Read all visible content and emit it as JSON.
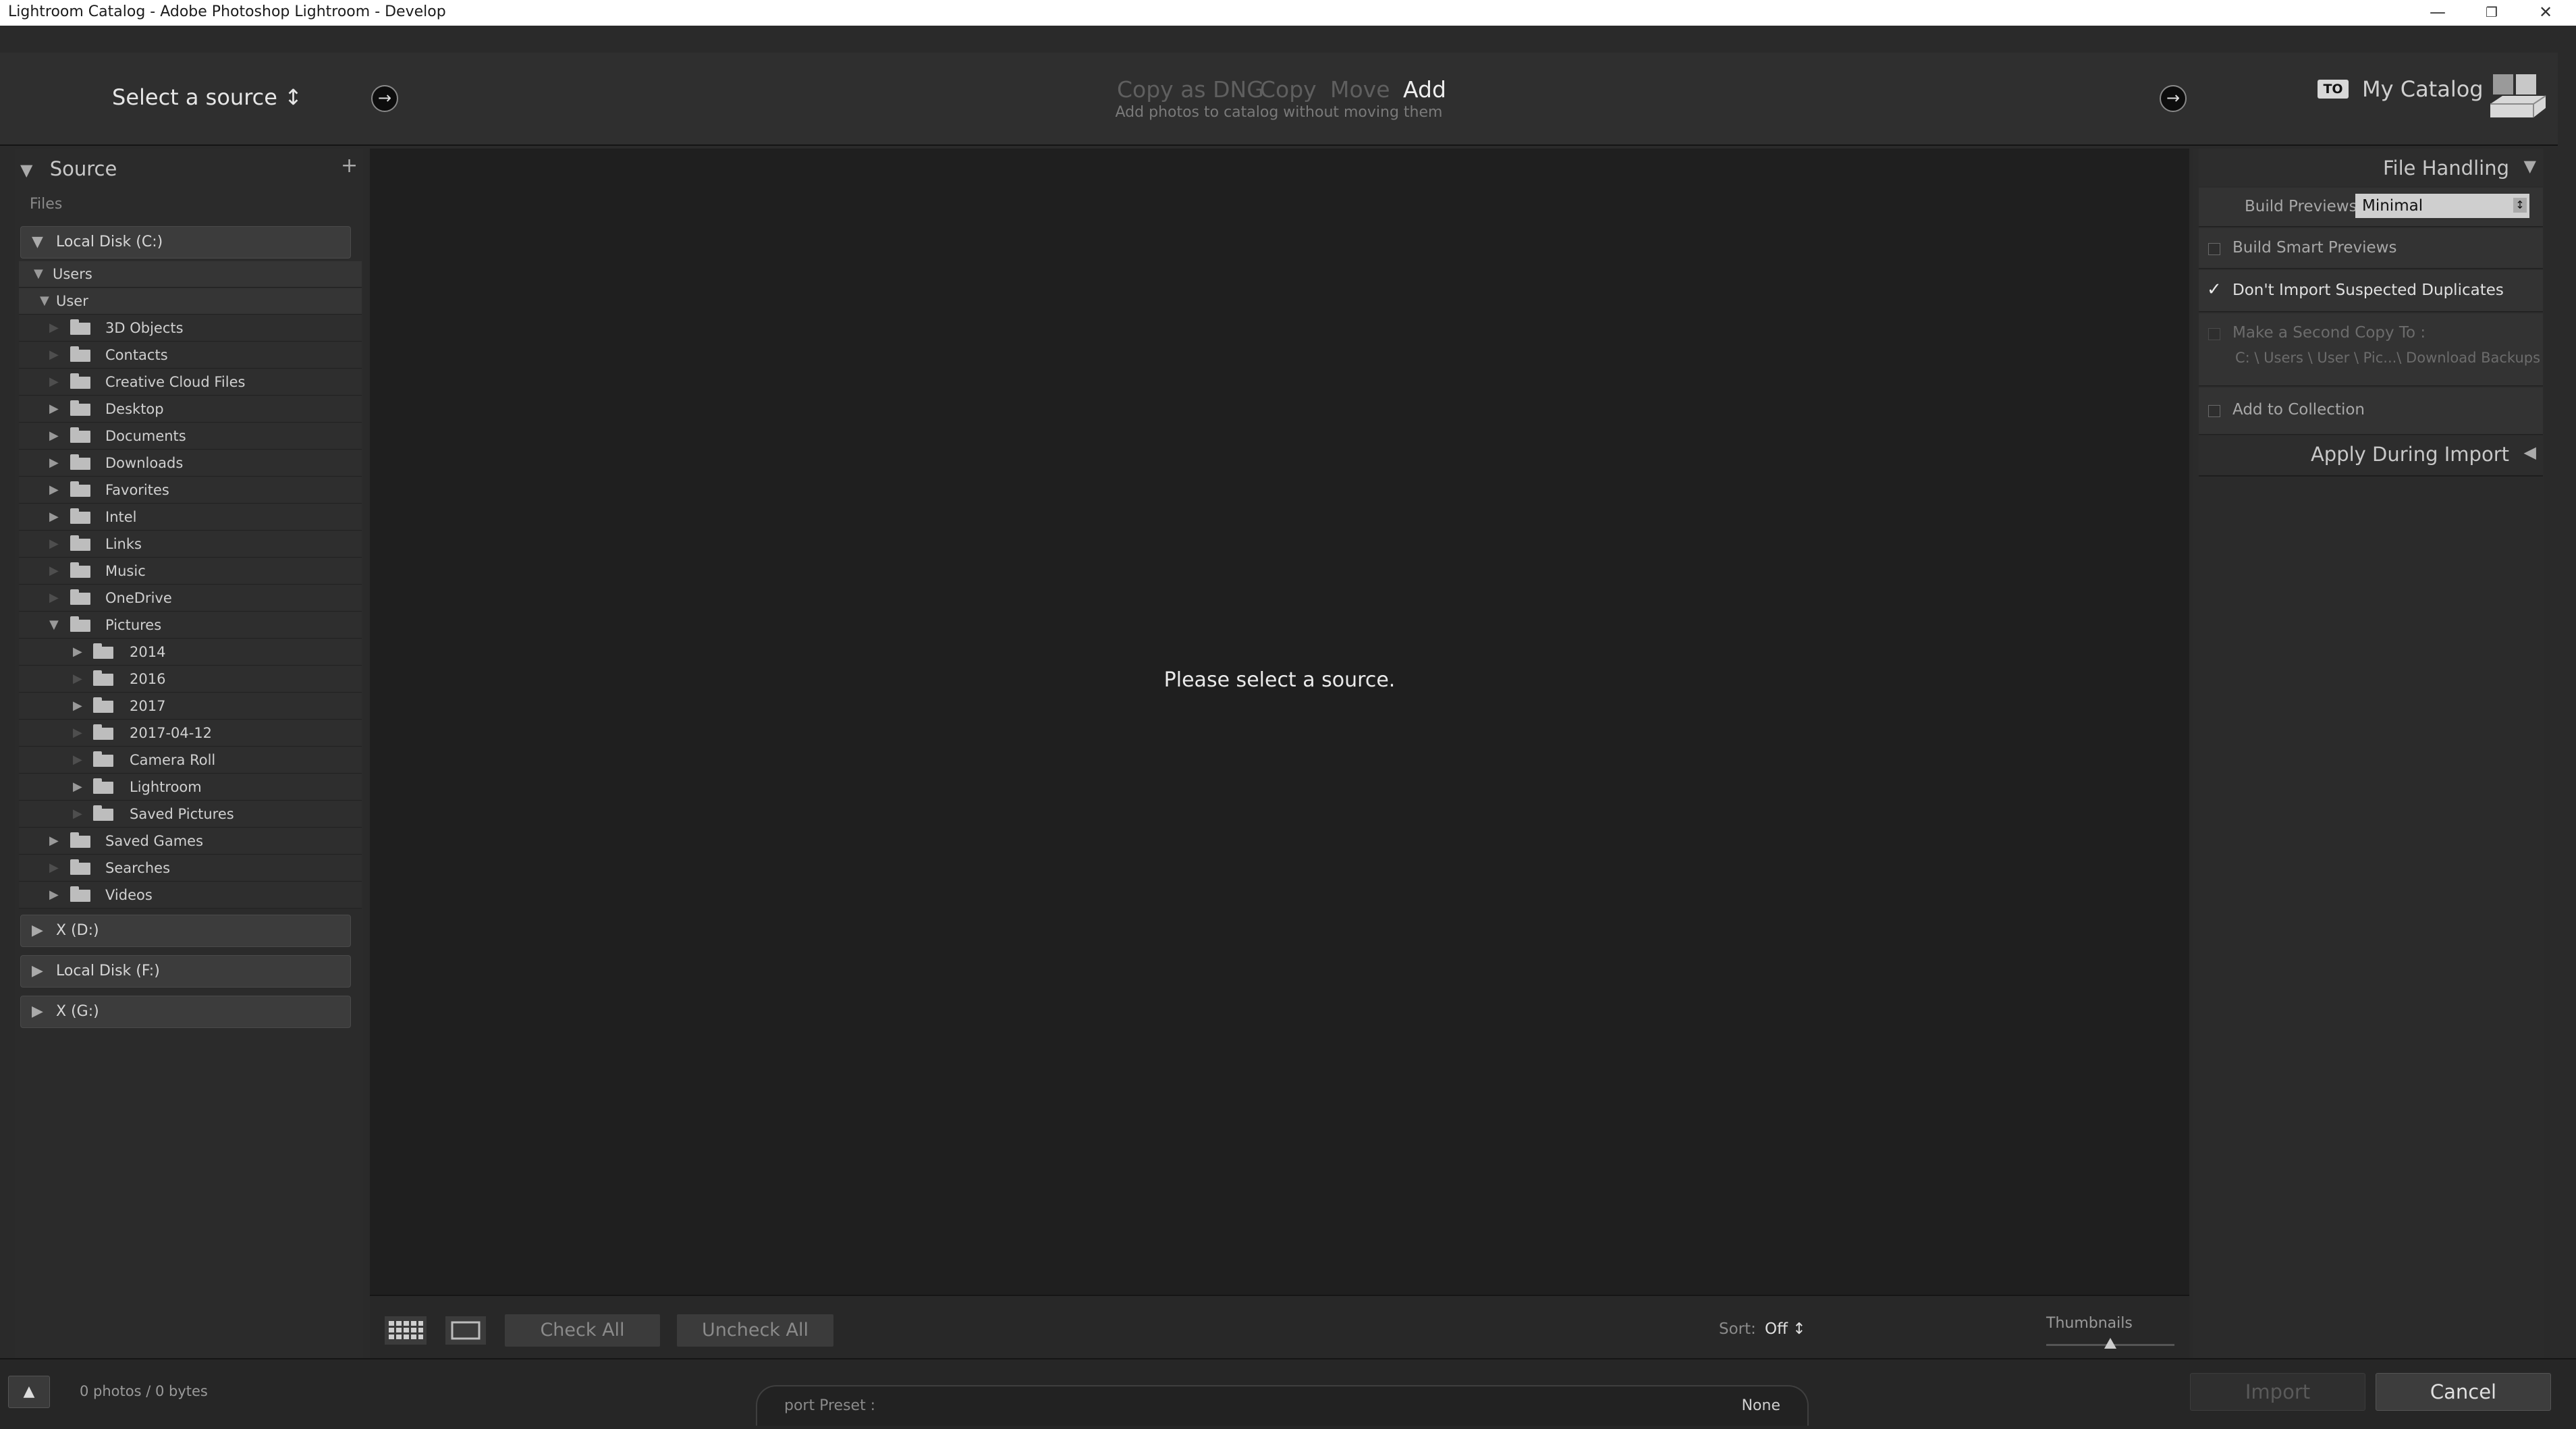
{
  "window": {
    "title": "Lightroom Catalog - Adobe Photoshop Lightroom - Develop",
    "minimize": "—",
    "restore": "❐",
    "close": "✕"
  },
  "header": {
    "source_title": "Select a source ↕",
    "modes": [
      "Copy as DNG",
      "Copy",
      "Move",
      "Add"
    ],
    "active_mode": "Add",
    "mode_subtitle": "Add photos to catalog without moving them",
    "destination_badge": "TO",
    "destination": "My Catalog",
    "arrow_icon": "→"
  },
  "source_panel": {
    "title": "Source",
    "add_symbol": "+",
    "files_label": "Files",
    "drives_top": [
      {
        "label": "Local Disk (C:)",
        "expanded": true
      }
    ],
    "tree": [
      {
        "name": "Users",
        "depth": 0,
        "expanded": true,
        "has_children": true
      },
      {
        "name": "User",
        "depth": 1,
        "expanded": true,
        "has_children": true
      },
      {
        "name": "3D Objects",
        "depth": 2,
        "has_children": false
      },
      {
        "name": "Contacts",
        "depth": 2,
        "has_children": false
      },
      {
        "name": "Creative Cloud Files",
        "depth": 2,
        "has_children": false
      },
      {
        "name": "Desktop",
        "depth": 2,
        "has_children": true
      },
      {
        "name": "Documents",
        "depth": 2,
        "has_children": true
      },
      {
        "name": "Downloads",
        "depth": 2,
        "has_children": true
      },
      {
        "name": "Favorites",
        "depth": 2,
        "has_children": true
      },
      {
        "name": "Intel",
        "depth": 2,
        "has_children": true
      },
      {
        "name": "Links",
        "depth": 2,
        "has_children": false
      },
      {
        "name": "Music",
        "depth": 2,
        "has_children": false
      },
      {
        "name": "OneDrive",
        "depth": 2,
        "has_children": false
      },
      {
        "name": "Pictures",
        "depth": 2,
        "has_children": true,
        "expanded": true
      },
      {
        "name": "2014",
        "depth": 3,
        "has_children": true
      },
      {
        "name": "2016",
        "depth": 3,
        "has_children": false
      },
      {
        "name": "2017",
        "depth": 3,
        "has_children": true
      },
      {
        "name": "2017-04-12",
        "depth": 3,
        "has_children": false
      },
      {
        "name": "Camera Roll",
        "depth": 3,
        "has_children": false
      },
      {
        "name": "Lightroom",
        "depth": 3,
        "has_children": true
      },
      {
        "name": "Saved Pictures",
        "depth": 3,
        "has_children": false
      },
      {
        "name": "Saved Games",
        "depth": 2,
        "has_children": true
      },
      {
        "name": "Searches",
        "depth": 2,
        "has_children": false
      },
      {
        "name": "Videos",
        "depth": 2,
        "has_children": true
      }
    ],
    "drives_bottom": [
      {
        "label": "X (D:)",
        "expanded": false
      },
      {
        "label": "Local Disk (F:)",
        "expanded": false
      },
      {
        "label": "X (G:)",
        "expanded": false
      }
    ]
  },
  "center": {
    "message": "Please select a source."
  },
  "toolbar": {
    "check_all": "Check All",
    "uncheck_all": "Uncheck All",
    "sort_label": "Sort:",
    "sort_value": "Off ↕",
    "thumbnails_label": "Thumbnails",
    "thumbnail_size": 0.5
  },
  "file_handling": {
    "title": "File Handling",
    "build_previews_label": "Build Previews",
    "build_previews_value": "Minimal",
    "build_smart_previews": {
      "label": "Build Smart Previews",
      "checked": false
    },
    "dont_import_duplicates": {
      "label": "Don't Import Suspected Duplicates",
      "checked": true
    },
    "second_copy": {
      "label": "Make a Second Copy To :",
      "path": "C: \\ Users \\ User \\ Pic...\\ Download Backups",
      "checked": false
    },
    "add_to_collection": {
      "label": "Add to Collection",
      "checked": false
    }
  },
  "apply_during_import": {
    "title": "Apply During Import"
  },
  "footer": {
    "photo_count": "0 photos / 0 bytes",
    "preset_label": "port Preset :",
    "preset_value": "None",
    "import_button": "Import",
    "cancel_button": "Cancel"
  },
  "colors": {
    "panel_bg": "#2b2b2b",
    "center_bg": "#1f1f1f",
    "active_mode": "#eeeeee",
    "inactive_mode": "#5f5f5f"
  }
}
